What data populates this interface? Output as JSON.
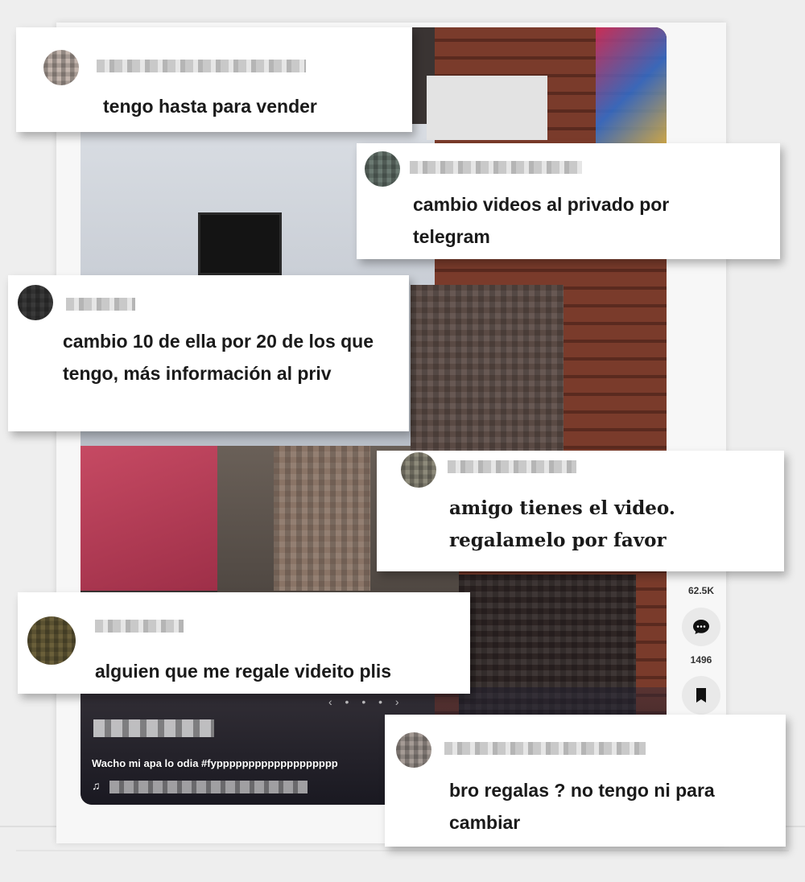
{
  "comments": [
    {
      "text": "tengo hasta para vender"
    },
    {
      "text": "cambio videos al privado por telegram"
    },
    {
      "text": "cambio 10 de ella por 20 de los que tengo, más información al priv"
    },
    {
      "text": "amigo tienes el video. regalamelo por favor"
    },
    {
      "text": "alguien que me regale videito plis"
    },
    {
      "text": "bro regalas ? no tengo ni para cambiar"
    }
  ],
  "video": {
    "caption": "Wacho mi apa lo odia #fyppppppppppppppppppp",
    "music_icon": "♫"
  },
  "rail": {
    "comments_count": "62.5K",
    "saves_count": "1496"
  },
  "icons": {
    "comment": "comment-bubble-icon",
    "bookmark": "bookmark-icon",
    "music": "music-note-icon"
  }
}
